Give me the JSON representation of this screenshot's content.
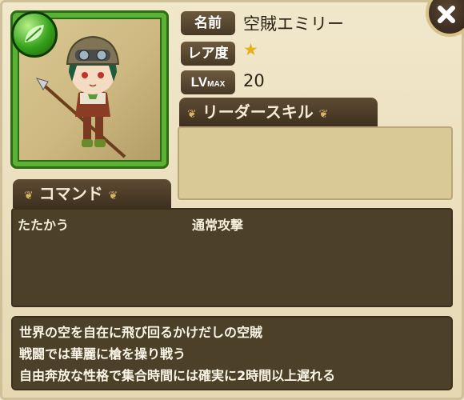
{
  "character": {
    "name_label": "名前",
    "name": "空賊エミリー",
    "rarity_label": "レア度",
    "rarity_stars": 1,
    "level_label": "LV",
    "level_max_label": "MAX",
    "level_value": "20"
  },
  "leader_skill": {
    "header": "リーダースキル"
  },
  "command": {
    "header": "コマンド",
    "items": [
      "たたかう",
      "通常攻撃"
    ]
  },
  "description": {
    "lines": [
      "世界の空を自在に飛び回るかけだしの空賊",
      "戦闘では華麗に槍を操り戦う",
      "自由奔放な性格で集合時間には確実に2時間以上遅れる"
    ]
  },
  "colors": {
    "element": "#35a21b",
    "panel": "#ede2c2",
    "dark_box": "#4c4028",
    "header": "#4a3b27"
  },
  "icons": {
    "element": "leaf-orb-icon",
    "rarity": "star-icon",
    "close": "close-icon"
  }
}
